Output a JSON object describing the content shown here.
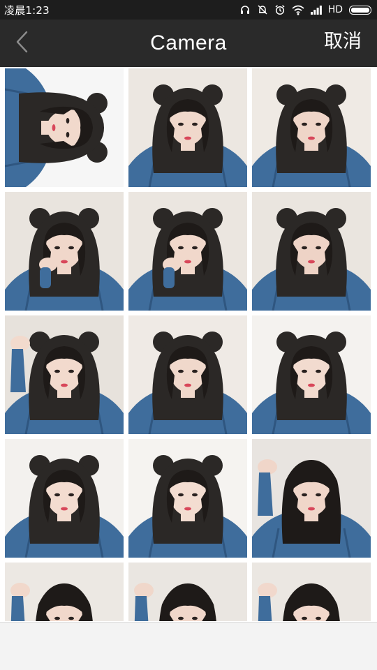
{
  "status_bar": {
    "time": "凌晨1:23",
    "network_label": "HD",
    "icons": [
      "headset-icon",
      "mute-icon",
      "alarm-icon",
      "wifi-icon",
      "signal-icon",
      "battery-icon"
    ]
  },
  "nav": {
    "title": "Camera",
    "cancel_label": "取消",
    "back_icon": "chevron-left-icon"
  },
  "colors": {
    "status_bar_bg": "#1d1d1d",
    "nav_bar_bg": "#2a2a2a",
    "nav_text": "#ffffff",
    "bottom_bar_bg": "#f3f3f3"
  },
  "gallery": {
    "columns": 3,
    "photos": [
      {
        "hood": true,
        "rotate": 90,
        "pose": "none",
        "bg": "#f6f6f6",
        "tone": "#f1d9cc"
      },
      {
        "hood": true,
        "rotate": 0,
        "pose": "none",
        "bg": "#ece7e1",
        "tone": "#f0d8cb"
      },
      {
        "hood": true,
        "rotate": 0,
        "pose": "none",
        "bg": "#efeae4",
        "tone": "#efd5c8"
      },
      {
        "hood": true,
        "rotate": 0,
        "pose": "hand-chin",
        "bg": "#e9e4de",
        "tone": "#f0d7ca"
      },
      {
        "hood": true,
        "rotate": 0,
        "pose": "hand-chin",
        "bg": "#ebe6e0",
        "tone": "#f1d8cb"
      },
      {
        "hood": true,
        "rotate": 0,
        "pose": "none",
        "bg": "#eae5df",
        "tone": "#eed3c6"
      },
      {
        "hood": true,
        "rotate": 0,
        "pose": "hand-raised",
        "bg": "#e7e2dc",
        "tone": "#f2dacd"
      },
      {
        "hood": true,
        "rotate": 0,
        "pose": "none",
        "bg": "#efeae5",
        "tone": "#f0d8cb"
      },
      {
        "hood": true,
        "rotate": 0,
        "pose": "none",
        "bg": "#f4f2ef",
        "tone": "#f2dbcf"
      },
      {
        "hood": true,
        "rotate": 0,
        "pose": "none",
        "bg": "#f3f1ee",
        "tone": "#f3dcd0"
      },
      {
        "hood": true,
        "rotate": 0,
        "pose": "none",
        "bg": "#f5f3f0",
        "tone": "#f3ddd1"
      },
      {
        "hood": false,
        "rotate": 0,
        "pose": "hand-raised",
        "bg": "#e8e4e0",
        "tone": "#f0d6c9"
      },
      {
        "hood": false,
        "rotate": 0,
        "pose": "hand-raised",
        "bg": "#ece8e3",
        "tone": "#f1d8cb"
      },
      {
        "hood": false,
        "rotate": 0,
        "pose": "hand-raised",
        "bg": "#eae6e1",
        "tone": "#f0d7ca"
      },
      {
        "hood": false,
        "rotate": 0,
        "pose": "hand-raised",
        "bg": "#ebe7e2",
        "tone": "#f1d8cc"
      }
    ]
  }
}
